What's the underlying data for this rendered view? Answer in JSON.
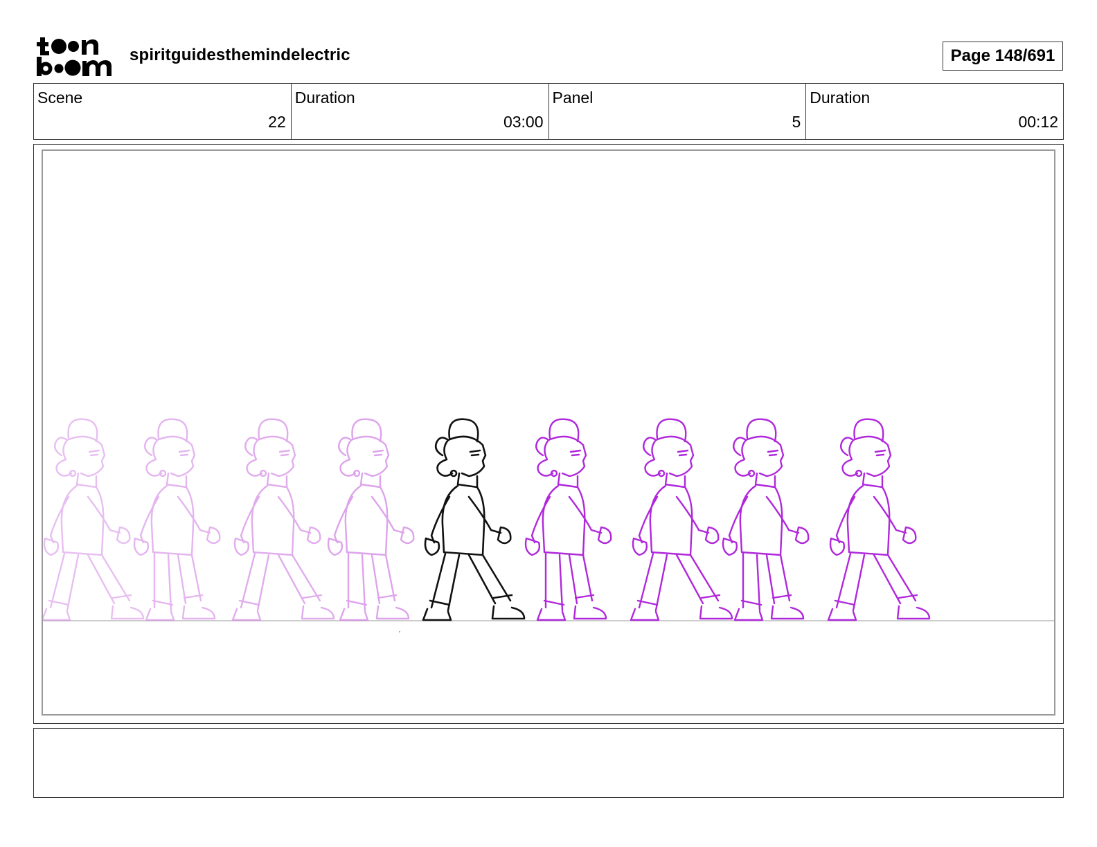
{
  "header": {
    "logo_text": "toon boom",
    "project_title": "spiritguidesthemindelectric",
    "page_indicator": "Page 148/691"
  },
  "info": {
    "scene_label": "Scene",
    "scene_value": "22",
    "scene_duration_label": "Duration",
    "scene_duration_value": "03:00",
    "panel_label": "Panel",
    "panel_value": "5",
    "panel_duration_label": "Duration",
    "panel_duration_value": "00:12"
  },
  "panel": {
    "figure_count": 9,
    "current_figure_index": 4,
    "colors": {
      "current_drawing": "#111111",
      "onion_skin_past": "#d58be6",
      "onion_skin_future": "#b028db",
      "ground_line": "#cccccc",
      "frame_border": "#9a9a9a"
    }
  },
  "notes": {
    "text": ""
  }
}
